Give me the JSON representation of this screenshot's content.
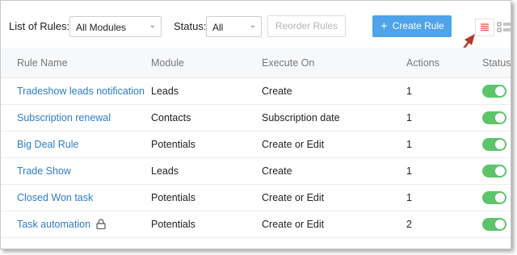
{
  "toolbar": {
    "list_label": "List of Rules:",
    "module_select_value": "All Modules",
    "status_label": "Status:",
    "status_select_value": "All",
    "reorder_label": "Reorder Rules",
    "create_label": "Create Rule",
    "create_icon": "plus-icon",
    "accent_color": "#4ea3ea"
  },
  "table": {
    "columns": [
      "Rule Name",
      "Module",
      "Execute On",
      "Actions",
      "Status"
    ],
    "rows": [
      {
        "name": "Tradeshow leads notification",
        "module": "Leads",
        "execute_on": "Create",
        "actions": "1",
        "status": "on",
        "locked": false
      },
      {
        "name": "Subscription renewal",
        "module": "Contacts",
        "execute_on": "Subscription date",
        "actions": "1",
        "status": "on",
        "locked": false
      },
      {
        "name": "Big Deal Rule",
        "module": "Potentials",
        "execute_on": "Create or Edit",
        "actions": "1",
        "status": "on",
        "locked": false
      },
      {
        "name": "Trade Show",
        "module": "Leads",
        "execute_on": "Create",
        "actions": "1",
        "status": "on",
        "locked": false
      },
      {
        "name": "Closed Won task",
        "module": "Potentials",
        "execute_on": "Create or Edit",
        "actions": "1",
        "status": "on",
        "locked": false
      },
      {
        "name": "Task automation",
        "module": "Potentials",
        "execute_on": "Create or Edit",
        "actions": "2",
        "status": "on",
        "locked": true
      }
    ]
  },
  "colors": {
    "link": "#2f7dc6",
    "toggle_on": "#5cc56a",
    "annotation_arrow": "#b23a2a"
  }
}
